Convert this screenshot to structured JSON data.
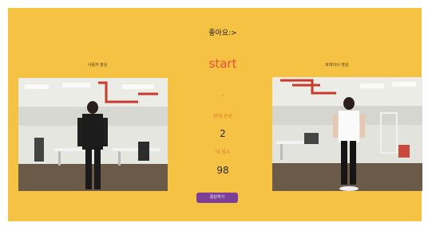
{
  "header": {
    "title": "좋아요:>"
  },
  "left_panel": {
    "label": "사용자 영상",
    "icon": "user-camera-video"
  },
  "right_panel": {
    "label": "트레이너 영상",
    "icon": "trainer-video"
  },
  "center": {
    "status": "start",
    "dash": "-",
    "current_count_label": "현재 순위",
    "current_count_value": "2",
    "score_label": "내 점수",
    "score_value": "98"
  },
  "stop_button": {
    "label": "중단하기"
  },
  "colors": {
    "background": "#f5c244",
    "status": "#ef4b36",
    "button": "#7b3f97",
    "label": "#e07930"
  }
}
